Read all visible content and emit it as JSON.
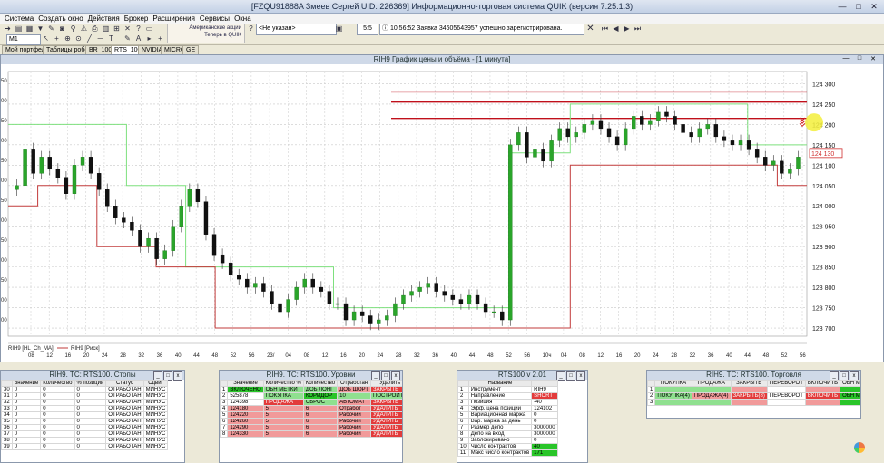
{
  "app": {
    "title": "[FZQU91888A Змеев Сергей UID: 226369] Информационно-торговая система QUIK (версия 7.25.1.3)"
  },
  "menu": [
    "Система",
    "Создать окно",
    "Действия",
    "Брокер",
    "Расширения",
    "Сервисы",
    "Окна"
  ],
  "toolbar": {
    "interval": "M1",
    "promo_line1": "Американские акции",
    "promo_line2": "Теперь в QUIK",
    "account_select": "<Не указан>",
    "counter": "5:5",
    "message_time": "10:56:52",
    "message": "Заявка 34605643957 успешно зарегистрирована."
  },
  "tabs": [
    "Мой портфель",
    "Таблицы робота",
    "BR_1000",
    "RTS_1000",
    "NVIDIA",
    "MICRON",
    "GE"
  ],
  "chart": {
    "title": "RIH9 График цены и объёма - [1 минута]",
    "legend": [
      "RIH9 [HL_Ch_MA]",
      "RIH9 [Риск]"
    ],
    "y_ticks": [
      "124 300",
      "124 250",
      "124 200",
      "124 150",
      "124 100",
      "124 050",
      "124 000",
      "123 950",
      "123 900",
      "123 850",
      "123 800",
      "123 750",
      "123 700"
    ],
    "current_price_label": "124 130",
    "x_ticks": [
      "08",
      "12",
      "16",
      "20",
      "24",
      "28",
      "32",
      "36",
      "40",
      "44",
      "48",
      "52",
      "56",
      "23/",
      "04",
      "08",
      "12",
      "16",
      "20",
      "24",
      "28",
      "32",
      "36",
      "40",
      "44",
      "48",
      "52",
      "56",
      "10ч",
      "04",
      "08",
      "12",
      "16",
      "20",
      "24",
      "28",
      "32",
      "36",
      "40",
      "44",
      "48",
      "52",
      "56"
    ],
    "left_axis_ticks": [
      "50",
      "00",
      "50",
      "00",
      "50",
      "00",
      "50",
      "00",
      "50",
      "00",
      "50",
      "00",
      "00"
    ]
  },
  "chart_data": {
    "type": "candlestick",
    "ylim": [
      123680,
      124330
    ],
    "levels": [
      124280,
      124255,
      124215
    ],
    "series": [
      {
        "name": "RIH9 [HL_Ch_MA]",
        "values": [
          124200,
          124200,
          124200,
          124200,
          124050,
          124050,
          123850,
          123850,
          123850,
          123850,
          123850,
          123750,
          123750,
          123750,
          123750,
          123750,
          123750,
          124130,
          124130,
          124250,
          124250,
          124250,
          124250,
          124250,
          124250,
          124150,
          124150
        ]
      },
      {
        "name": "RIH9 [Риск]",
        "values": [
          124000,
          124050,
          124050,
          123900,
          123900,
          123850,
          123850,
          123700,
          123700,
          123700,
          123700,
          123700,
          123700,
          123700,
          123700,
          123700,
          123700,
          123700,
          123700,
          124100,
          124100,
          124100,
          124100,
          124100,
          124100,
          124100,
          124050
        ]
      }
    ],
    "close": [
      124050,
      124140,
      124080,
      124120,
      124090,
      124070,
      124030,
      124100,
      124120,
      124080,
      124040,
      124000,
      123970,
      123960,
      123940,
      123900,
      123920,
      123870,
      123890,
      123950,
      124000,
      124040,
      124010,
      123930,
      123880,
      123860,
      123830,
      123820,
      123800,
      123810,
      123790,
      123760,
      123740,
      123770,
      123800,
      123820,
      123800,
      123790,
      123760,
      123760,
      123720,
      123740,
      123730,
      123710,
      123720,
      123730,
      123760,
      123780,
      123790,
      123800,
      123810,
      123790,
      123780,
      123770,
      123760,
      123780,
      123760,
      123740,
      123740,
      123720,
      124150,
      124180,
      124120,
      124140,
      124110,
      124160,
      124190,
      124170,
      124180,
      124200,
      124210,
      124190,
      124170,
      124150,
      124190,
      124220,
      124200,
      124210,
      124230,
      124220,
      124200,
      124180,
      124170,
      124190,
      124200,
      124170,
      124160,
      124150,
      124160,
      124140,
      124120,
      124100,
      124110,
      124080,
      124090,
      124120
    ]
  },
  "panels": {
    "stops": {
      "title": "RIH9. TC: RTS100. Стопы",
      "headers": [
        "",
        "Значение",
        "Количество",
        "% позиции",
        "Статус",
        "Сдвиг"
      ],
      "rows": [
        [
          "30",
          "0",
          "0",
          "0",
          "ОТРАБОТАН",
          "МИНУС"
        ],
        [
          "31",
          "0",
          "0",
          "0",
          "ОТРАБОТАН",
          "МИНУС"
        ],
        [
          "32",
          "0",
          "0",
          "0",
          "ОТРАБОТАН",
          "МИНУС"
        ],
        [
          "33",
          "0",
          "0",
          "0",
          "ОТРАБОТАН",
          "МИНУС"
        ],
        [
          "34",
          "0",
          "0",
          "0",
          "ОТРАБОТАН",
          "МИНУС"
        ],
        [
          "35",
          "0",
          "0",
          "0",
          "ОТРАБОТАН",
          "МИНУС"
        ],
        [
          "36",
          "0",
          "0",
          "0",
          "ОТРАБОТАН",
          "МИНУС"
        ],
        [
          "37",
          "0",
          "0",
          "0",
          "ОТРАБОТАН",
          "МИНУС"
        ],
        [
          "38",
          "0",
          "0",
          "0",
          "ОТРАБОТАН",
          "МИНУС"
        ],
        [
          "39",
          "0",
          "0",
          "0",
          "ОТРАБОТАН",
          "МИНУС"
        ]
      ]
    },
    "levels": {
      "title": "RIH9. TC: RTS100. Уровни",
      "headers": [
        "",
        "Значение",
        "Количество %",
        "Количество",
        "Отработан",
        "Удалить",
        "L/S"
      ],
      "rows": [
        [
          "1",
          "ВКЛЮЧЕНО",
          "ОБН МЕТКИ",
          "ДОБ ЛОНГ",
          "ДОБ ШОРТ",
          "ЗАКРЫТЬ",
          ""
        ],
        [
          "2",
          "525878",
          "ПОКУПКА",
          "КОРИДОР",
          "10",
          "ПОСТРОИТЬ",
          ""
        ],
        [
          "3",
          "124398",
          "ПРОДАЖА",
          "СБРОС",
          "АВТОМАТ",
          "ЗАКРЫТЬ",
          ""
        ],
        [
          "4",
          "124180",
          "5",
          "6",
          "Отработ",
          "УДАЛИТЬ",
          "S"
        ],
        [
          "5",
          "124220",
          "5",
          "6",
          "Рабочий",
          "УДАЛИТЬ",
          "S"
        ],
        [
          "6",
          "124260",
          "5",
          "6",
          "Рабочий",
          "УДАЛИТЬ",
          "S"
        ],
        [
          "7",
          "124290",
          "5",
          "6",
          "Рабочий",
          "УДАЛИТЬ",
          "S"
        ],
        [
          "8",
          "124330",
          "5",
          "6",
          "Рабочий",
          "УДАЛИТЬ",
          "S"
        ]
      ]
    },
    "rts": {
      "title": "RTS100 v 2.01",
      "headers": [
        "",
        "Название",
        ""
      ],
      "rows": [
        [
          "1",
          "Инструмент",
          "RIH9"
        ],
        [
          "2",
          "Направление",
          "SHORT"
        ],
        [
          "3",
          "Позиция",
          "-40"
        ],
        [
          "4",
          "Эфф. цена позиции",
          "124102"
        ],
        [
          "5",
          "Вариационная маржа",
          "0"
        ],
        [
          "6",
          "Вар. маржа за день",
          "0"
        ],
        [
          "7",
          "Размер депо",
          "3000000"
        ],
        [
          "8",
          "Депо на вход",
          "3000000"
        ],
        [
          "9",
          "Заблокировано",
          "0"
        ],
        [
          "10",
          "Число контрактов",
          "40"
        ],
        [
          "11",
          "Макс число контрактов",
          "171"
        ]
      ]
    },
    "trade": {
      "title": "RIH9. TC: RTS100. Торговля",
      "headers": [
        "",
        "ПОКУПКА",
        "ПРОДАЖА",
        "ЗАКРЫТЬ",
        "ПЕРЕВОРОТ",
        "ВКЛЮЧИТЬ",
        "ОБН МЕТК"
      ],
      "rows": [
        [
          "1",
          "",
          "",
          "",
          "",
          "",
          ""
        ],
        [
          "2",
          "ПОКУПКА(4)",
          "ПРОДАЖА(4)",
          "ЗАКРЫТЬ(8)",
          "ПЕРЕВОРОТ",
          "ВКЛЮЧИТЬ",
          "ОБН МЕТК"
        ],
        [
          "3",
          "",
          "",
          "",
          "",
          "",
          ""
        ]
      ]
    }
  },
  "colors": {
    "accent_green": "#29c529",
    "accent_red": "#e23b3b",
    "ma_line": "#7ee07e",
    "risk_line": "#c23b3b",
    "level_line": "#c0101b"
  }
}
